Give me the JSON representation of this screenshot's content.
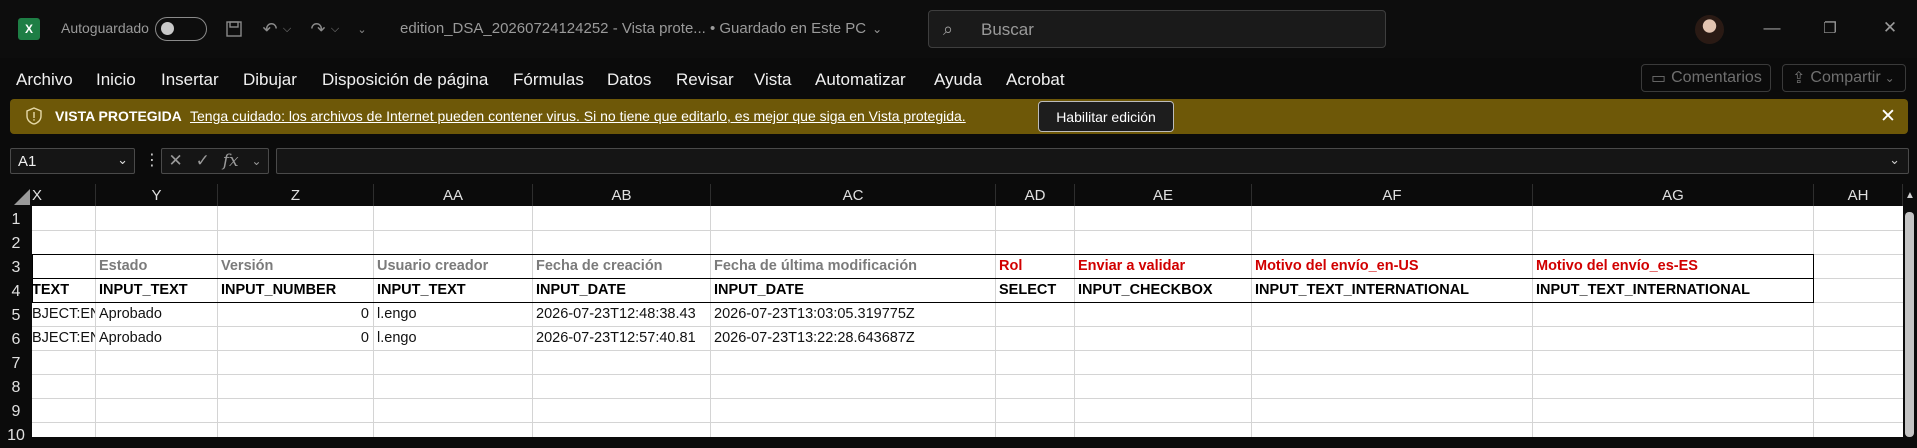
{
  "titlebar": {
    "app_logo": "X",
    "autosave_label": "Autoguardado",
    "doc_title": "edition_DSA_20260724124252  -  Vista prote...  •  Guardado en Este PC",
    "search_placeholder": "Buscar"
  },
  "menu": {
    "items": [
      "Archivo",
      "Inicio",
      "Insertar",
      "Dibujar",
      "Disposición de página",
      "Fórmulas",
      "Datos",
      "Revisar",
      "Vista",
      "Automatizar",
      "Ayuda",
      "Acrobat"
    ],
    "comments_label": "Comentarios",
    "share_label": "Compartir"
  },
  "protected_view": {
    "title": "VISTA PROTEGIDA",
    "message": "Tenga cuidado: los archivos de Internet pueden contener virus. Si no tiene que editarlo, es mejor que siga en Vista protegida.",
    "enable_button": "Habilitar edición",
    "bar_color": "#6e5808"
  },
  "formula_bar": {
    "name_box": "A1",
    "formula": ""
  },
  "grid": {
    "columns": [
      "X",
      "Y",
      "Z",
      "AA",
      "AB",
      "AC",
      "AD",
      "AE",
      "AF",
      "AG",
      "AH"
    ],
    "rows": [
      "1",
      "2",
      "3",
      "4",
      "5",
      "6",
      "7",
      "8",
      "9",
      "10"
    ],
    "row3": {
      "Y": "Estado",
      "Z": "Versión",
      "AA": "Usuario creador",
      "AB": "Fecha de creación",
      "AC": "Fecha de última modificación",
      "AD": "Rol",
      "AE": "Enviar a validar",
      "AF": "Motivo del envío_en-US",
      "AG": "Motivo del envío_es-ES"
    },
    "row4": {
      "X": "TEXT",
      "Y": "INPUT_TEXT",
      "Z": "INPUT_NUMBER",
      "AA": "INPUT_TEXT",
      "AB": "INPUT_DATE",
      "AC": "INPUT_DATE",
      "AD": "SELECT",
      "AE": "INPUT_CHECKBOX",
      "AF": "INPUT_TEXT_INTERNATIONAL",
      "AG": "INPUT_TEXT_INTERNATIONAL"
    },
    "row5": {
      "X": "BJECT:EN",
      "Y": "Aprobado",
      "Z": "0",
      "AA": "l.engo",
      "AB": "2026-07-23T12:48:38.43",
      "AC": "2026-07-23T13:03:05.319775Z"
    },
    "row6": {
      "X": "BJECT:EN",
      "Y": "Aprobado",
      "Z": "0",
      "AA": "l.engo",
      "AB": "2026-07-23T12:57:40.81",
      "AC": "2026-07-23T13:22:28.643687Z"
    },
    "colors": {
      "header_gray": "#7b7b7b",
      "header_red": "#d10000"
    }
  }
}
